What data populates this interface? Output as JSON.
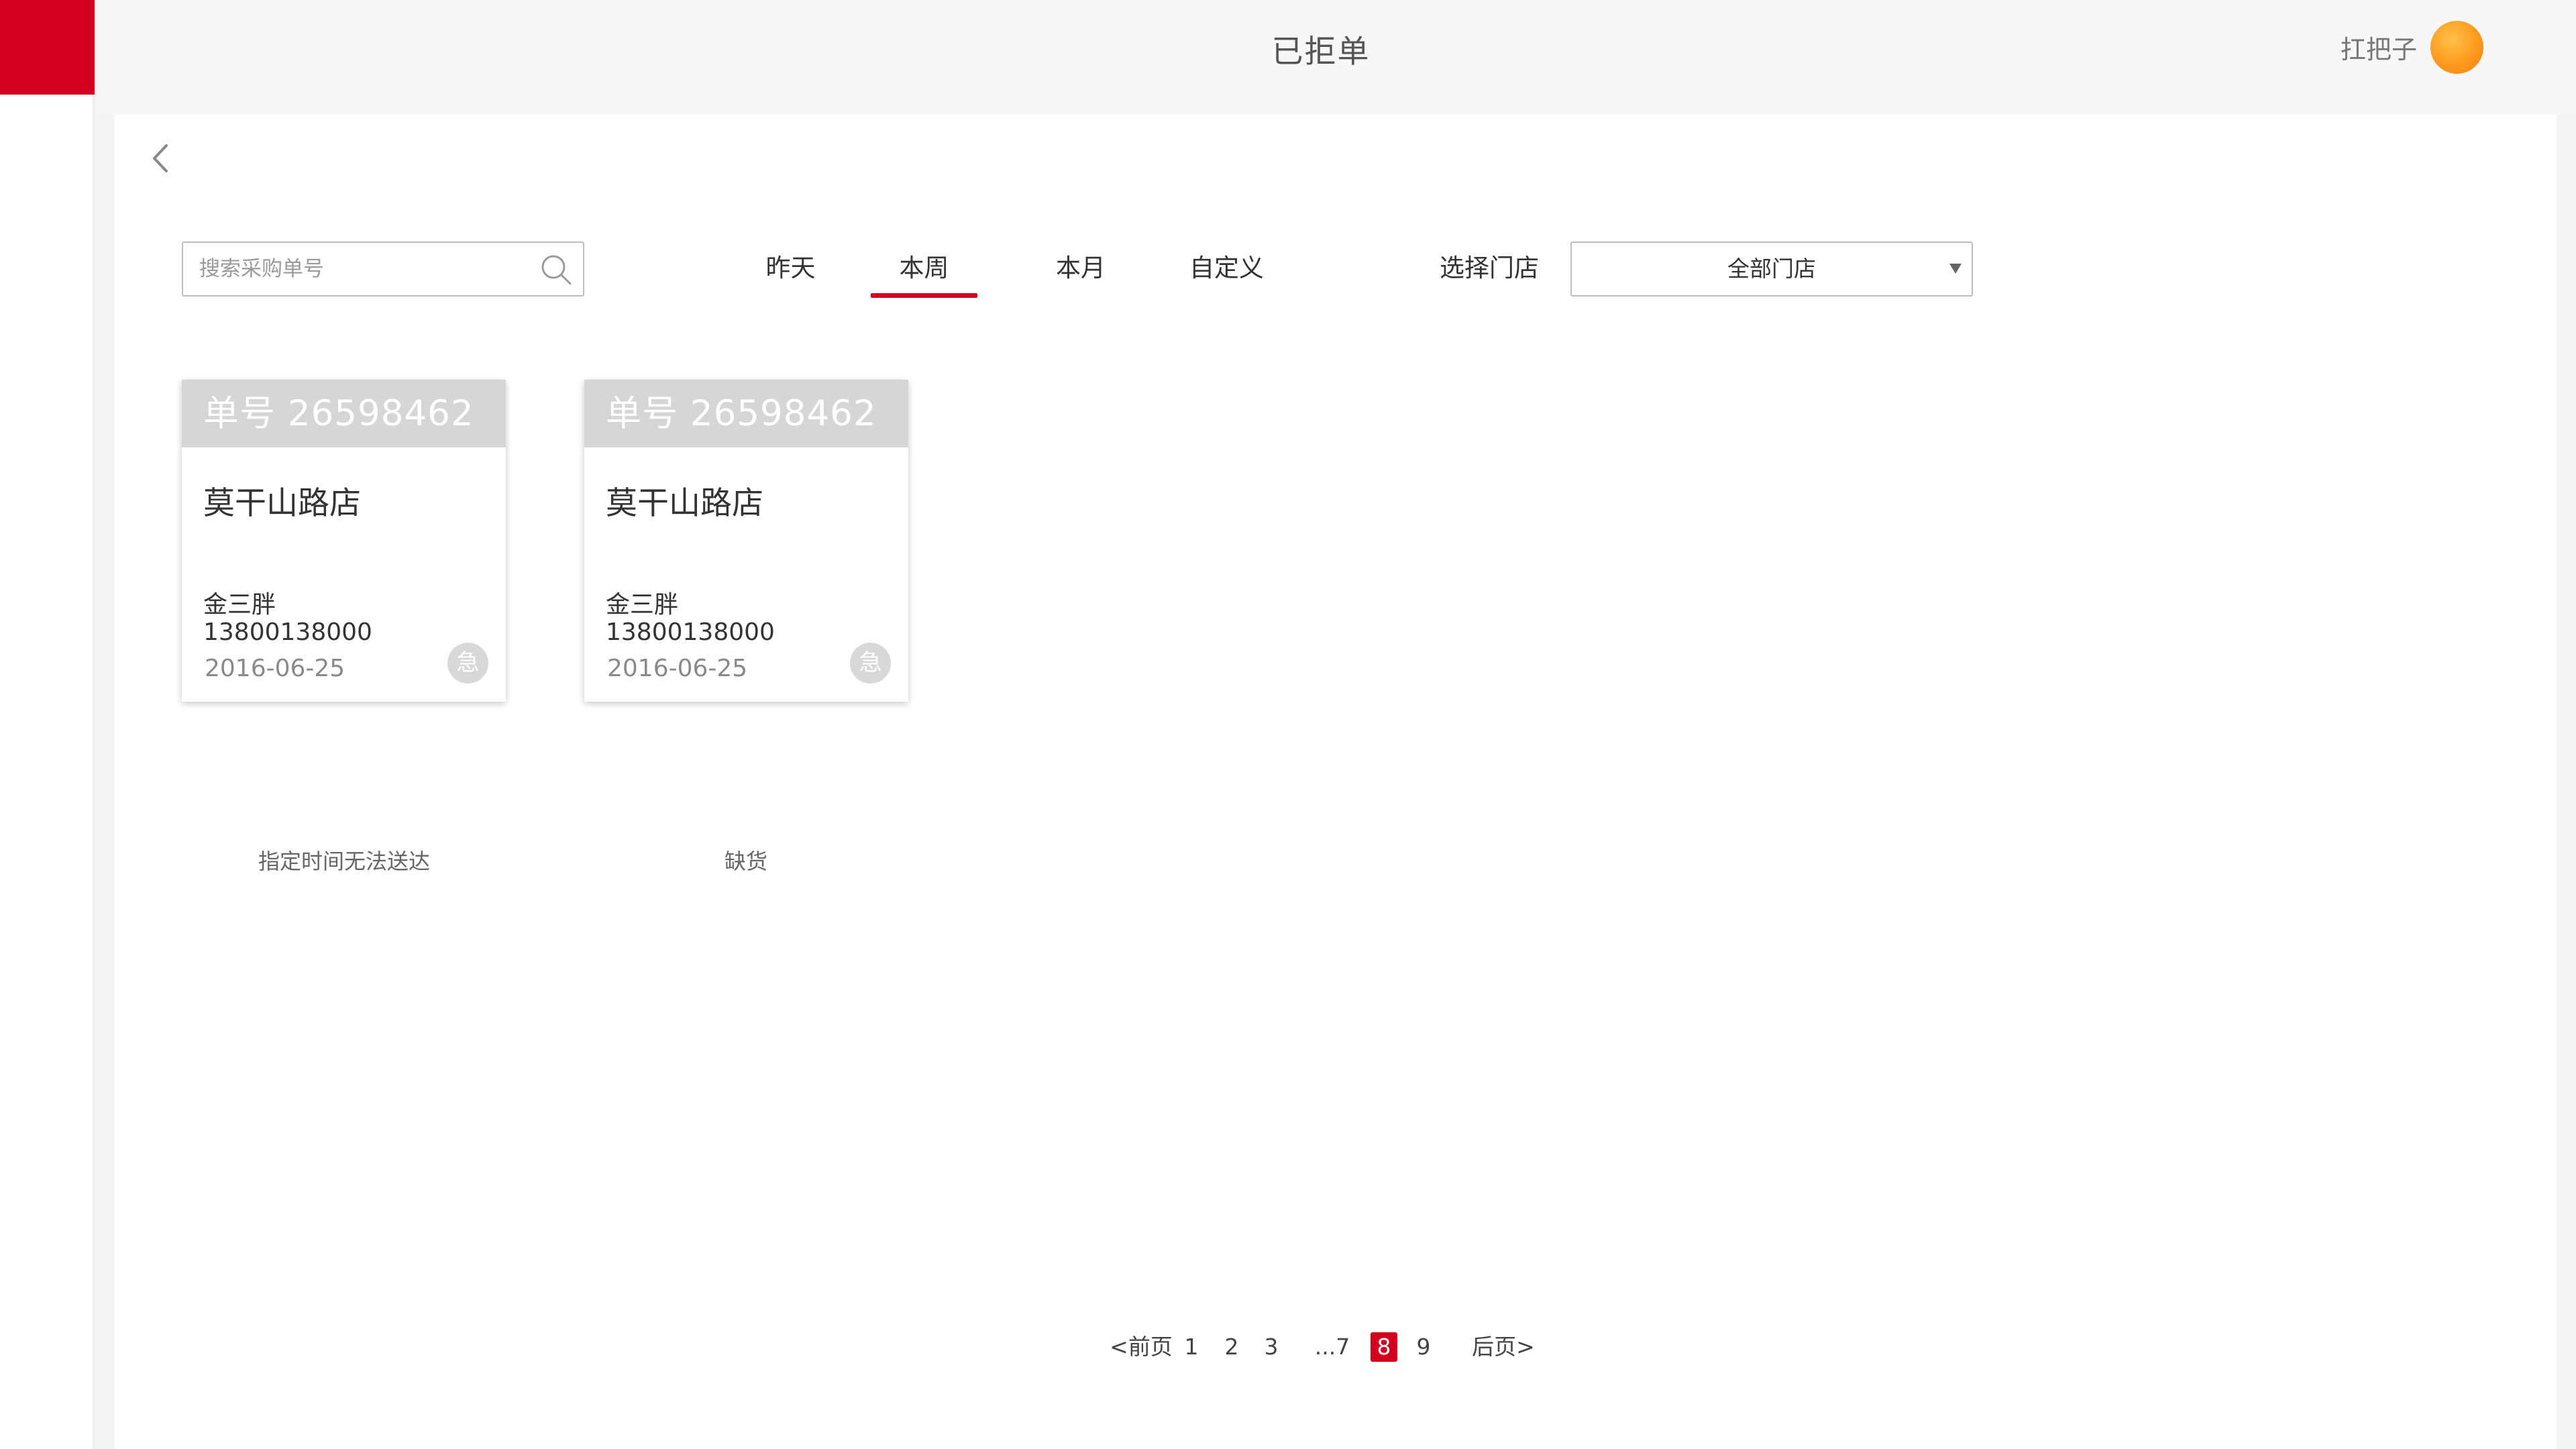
{
  "header": {
    "title": "已拒单",
    "user_name": "扛把子"
  },
  "toolbar": {
    "search_placeholder": "搜索采购单号",
    "tabs": [
      {
        "label": "昨天",
        "active": false
      },
      {
        "label": "本周",
        "active": true
      },
      {
        "label": "本月",
        "active": false
      },
      {
        "label": "自定义",
        "active": false
      }
    ],
    "store_label": "选择门店",
    "store_selected": "全部门店"
  },
  "orders": [
    {
      "order_no": "单号 26598462",
      "store": "莫干山路店",
      "contact": "金三胖",
      "phone": "13800138000",
      "date": "2016-06-25",
      "badge": "急",
      "reason": "指定时间无法送达"
    },
    {
      "order_no": "单号 26598462",
      "store": "莫干山路店",
      "contact": "金三胖",
      "phone": "13800138000",
      "date": "2016-06-25",
      "badge": "急",
      "reason": "缺货"
    }
  ],
  "pagination": {
    "prev": "<前页",
    "pages": [
      "1",
      "2",
      "3",
      "...7",
      "8",
      "9"
    ],
    "current": "8",
    "next": "后页>"
  },
  "colors": {
    "accent": "#d2001e",
    "card_header": "#d6d6d6",
    "avatar": "#ff9a1e"
  }
}
